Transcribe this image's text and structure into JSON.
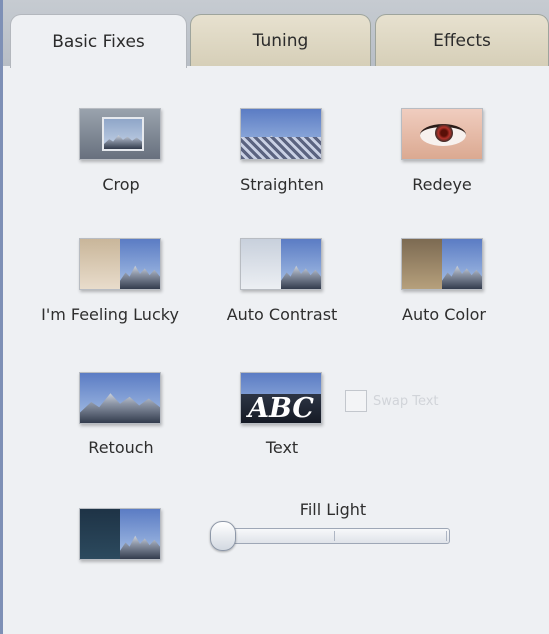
{
  "tabs": [
    {
      "label": "Basic Fixes",
      "active": true
    },
    {
      "label": "Tuning",
      "active": false
    },
    {
      "label": "Effects",
      "active": false
    }
  ],
  "tools": {
    "crop": "Crop",
    "straighten": "Straighten",
    "redeye": "Redeye",
    "feeling_lucky": "I'm Feeling Lucky",
    "auto_contrast": "Auto Contrast",
    "auto_color": "Auto Color",
    "retouch": "Retouch",
    "text": "Text"
  },
  "text_thumb": "ABC",
  "checkbox": {
    "label": "Swap Text",
    "checked": false,
    "enabled": false
  },
  "fill_light": {
    "label": "Fill Light",
    "value": 0
  },
  "colors": {
    "panel_bg": "#eef0f3",
    "tab_inactive": "#d6cfb8",
    "frame": "#7e90b6"
  }
}
